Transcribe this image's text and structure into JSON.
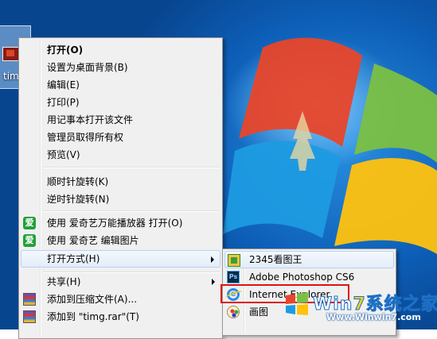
{
  "desktop": {
    "file_label": "timg"
  },
  "context_menu": {
    "items": [
      {
        "label": "打开(O)"
      },
      {
        "label": "设置为桌面背景(B)"
      },
      {
        "label": "编辑(E)"
      },
      {
        "label": "打印(P)"
      },
      {
        "label": "用记事本打开该文件"
      },
      {
        "label": "管理员取得所有权"
      },
      {
        "label": "预览(V)"
      },
      {
        "label": "顺时针旋转(K)"
      },
      {
        "label": "逆时针旋转(N)"
      },
      {
        "label": "使用 爱奇艺万能播放器 打开(O)"
      },
      {
        "label": "使用 爱奇艺 编辑图片"
      },
      {
        "label": "打开方式(H)"
      },
      {
        "label": "共享(H)"
      },
      {
        "label": "添加到压缩文件(A)..."
      },
      {
        "label": "添加到 \"timg.rar\"(T)"
      }
    ]
  },
  "open_with_submenu": {
    "items": [
      {
        "label": "2345看图王"
      },
      {
        "label": "Adobe Photoshop CS6"
      },
      {
        "label": "Internet Explorer"
      },
      {
        "label": "画图"
      }
    ]
  },
  "watermark": {
    "brand_prefix": "Win",
    "brand_seven": "7",
    "brand_suffix": "系统之家",
    "url": "Www.Winwin7.com"
  },
  "icons": {
    "iqiyi": "iqiyi-icon",
    "winrar": "winrar-icon",
    "viewer_2345": "image-viewer-2345-icon",
    "photoshop": "photoshop-icon",
    "ie": "internet-explorer-icon",
    "paint": "paint-icon"
  },
  "colors": {
    "highlight_border": "#e01010",
    "menu_bg": "#f0f0f0",
    "hover_border": "#b8d2f1"
  }
}
